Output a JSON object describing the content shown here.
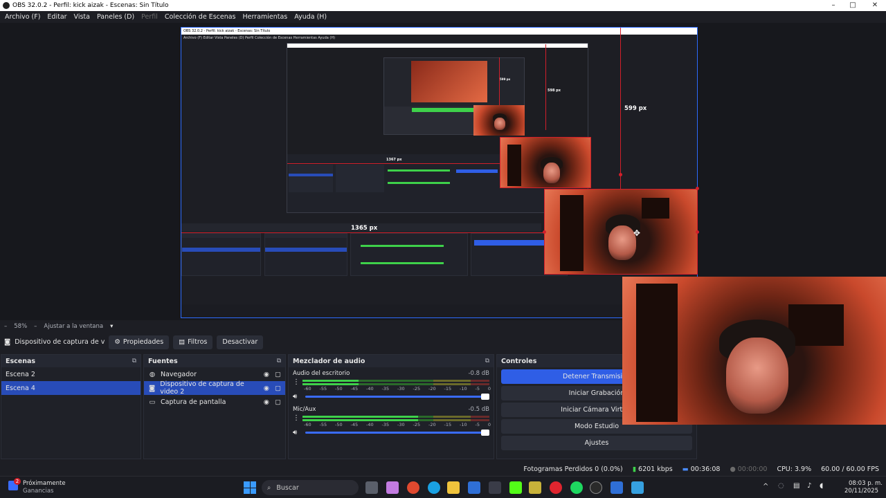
{
  "window": {
    "title": "OBS 32.0.2 - Perfil: kick aizak - Escenas: Sin Título",
    "min": "–",
    "max": "□",
    "close": "✕"
  },
  "menu": {
    "items": [
      "Archivo (F)",
      "Editar",
      "Vista",
      "Paneles (D)",
      "Perfil",
      "Colección de Escenas",
      "Herramientas",
      "Ayuda (H)"
    ]
  },
  "preview": {
    "nested_title": "OBS 32.0.2 - Perfil: kick aizak - Escenas: Sin Título",
    "nested_menu": "Archivo (F)   Editar   Vista   Paneles (D)   Perfil   Colección de Escenas   Herramientas   Ayuda (H)",
    "guide_599": "599 px",
    "guide_1365": "1365 px",
    "guide_598": "598 px",
    "guide_1367": "1367 px",
    "guide_tiny": "599 px"
  },
  "zoom": {
    "minus": "–",
    "level": "58%",
    "fit": "Ajustar a la ventana",
    "arrow": "▾"
  },
  "source_toolbar": {
    "source_name": "Dispositivo de captura de v",
    "properties": "Propiedades",
    "filters": "Filtros",
    "deactivate": "Desactivar"
  },
  "scenes": {
    "title": "Escenas",
    "items": [
      "Escena 2",
      "Escena 4"
    ],
    "selected_index": 1
  },
  "sources": {
    "title": "Fuentes",
    "items": [
      {
        "label": "Navegador",
        "icon": "globe-icon"
      },
      {
        "label": "Dispositivo de captura de video 2",
        "icon": "camera-icon"
      },
      {
        "label": "Captura de pantalla",
        "icon": "monitor-icon"
      }
    ],
    "selected_index": 1
  },
  "mixer": {
    "title": "Mezclador de audio",
    "channels": [
      {
        "name": "Audio del escritorio",
        "db": "-0.8 dB",
        "level": 0.3
      },
      {
        "name": "Mic/Aux",
        "db": "-0.5 dB",
        "level": 0.62
      }
    ],
    "ticks": [
      "-60",
      "-55",
      "-50",
      "-45",
      "-40",
      "-35",
      "-30",
      "-25",
      "-20",
      "-15",
      "-10",
      "-5",
      "0"
    ]
  },
  "controls": {
    "title": "Controles",
    "buttons": [
      "Detener Transmisión",
      "Iniciar Grabación",
      "Iniciar Cámara Virtual",
      "Modo Estudio",
      "Ajustes"
    ]
  },
  "status": {
    "dropped": "Fotogramas Perdidos 0 (0.0%)",
    "bitrate": "6201 kbps",
    "stream_time": "00:36:08",
    "rec_time": "00:00:00",
    "cpu": "CPU: 3.9%",
    "fps": "60.00 / 60.00 FPS"
  },
  "taskbar": {
    "weather_title": "Próximamente",
    "weather_sub": "Ganancias",
    "badge": "2",
    "search_placeholder": "Buscar",
    "time": "08:03 p. m.",
    "date": "20/11/2025",
    "chevron": "^"
  },
  "colors": {
    "accent": "#2f5ee6",
    "selection": "#284cb8",
    "guide_red": "#d21f2a",
    "background": "#1d1e24"
  }
}
